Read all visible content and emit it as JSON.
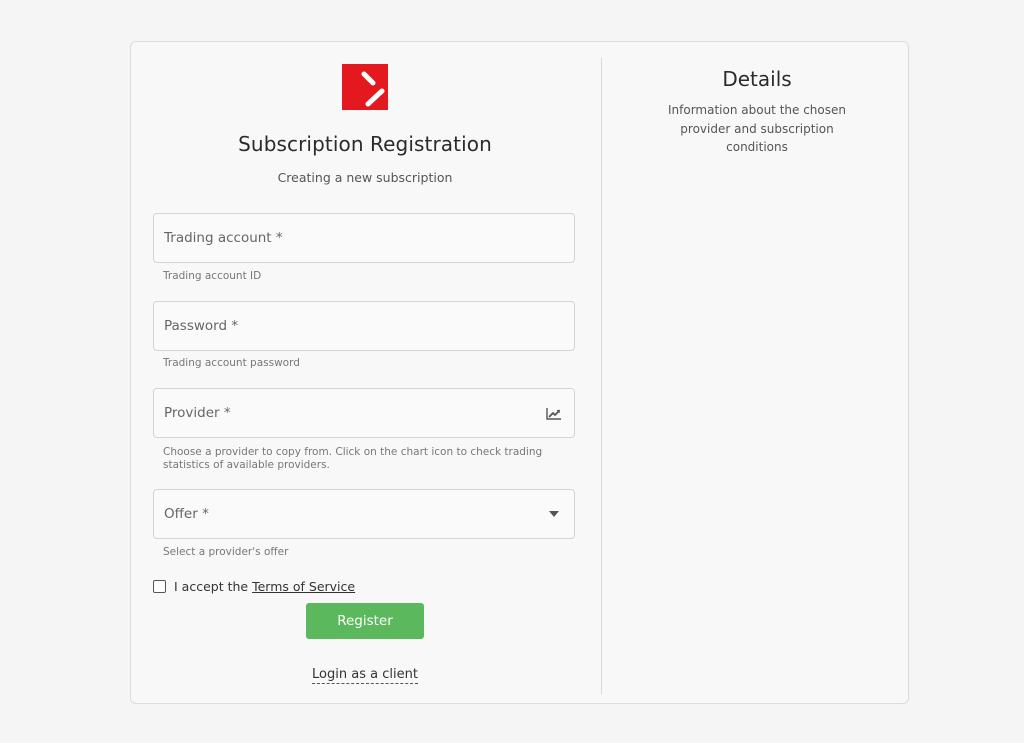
{
  "brand": {
    "logo_icon": "brand-logo-icon",
    "logo_color": "#e3191f"
  },
  "form": {
    "title": "Subscription Registration",
    "subtitle": "Creating a new subscription",
    "fields": {
      "trading_account": {
        "label": "Trading account *",
        "hint": "Trading account ID"
      },
      "password": {
        "label": "Password *",
        "hint": "Trading account password"
      },
      "provider": {
        "label": "Provider *",
        "hint": "Choose a provider to copy from. Click on the chart icon to check trading statistics of available providers.",
        "icon": "chart-icon"
      },
      "offer": {
        "label": "Offer *",
        "hint": "Select a provider's offer",
        "icon": "dropdown-arrow-icon"
      }
    },
    "terms": {
      "prefix": "I accept the",
      "link": "Terms of Service"
    },
    "register_label": "Register",
    "register_color": "#5cb85c",
    "login_link": "Login as a client"
  },
  "details": {
    "title": "Details",
    "text": "Information about the chosen provider and subscription conditions"
  }
}
